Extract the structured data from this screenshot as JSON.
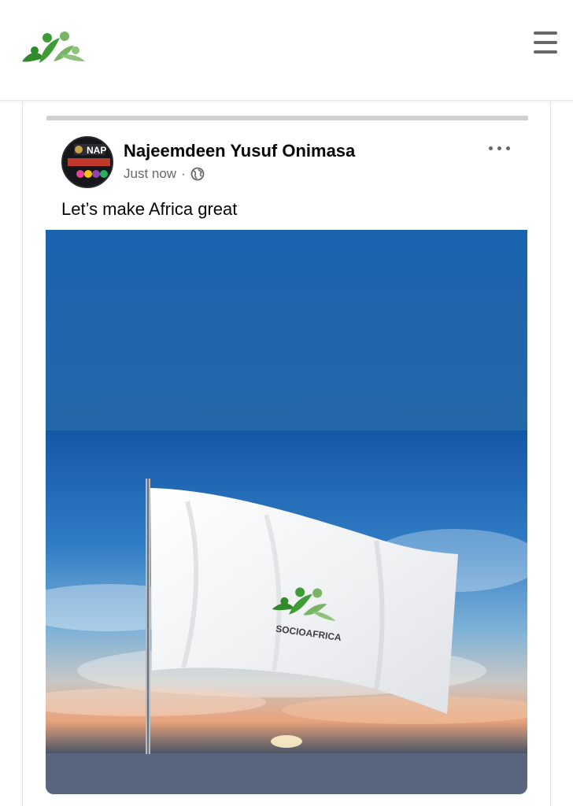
{
  "header": {
    "logo_icon": "socioafrica-logo-icon",
    "menu_icon": "hamburger-menu-icon"
  },
  "post": {
    "author": "Najeemdeen Yusuf Onimasa",
    "timestamp": "Just now",
    "separator": "·",
    "audience_icon": "globe-icon",
    "more_icon": "more-options-icon",
    "text": "Let’s make Africa great",
    "avatar_text": "NAP",
    "image": {
      "flag_brand": "SOCIOAFRICA"
    }
  },
  "colors": {
    "brand_green": "#3a8f2c",
    "brand_light_green": "#7fb96a",
    "sky_blue": "#1e66b0",
    "text_secondary": "#65676b"
  }
}
